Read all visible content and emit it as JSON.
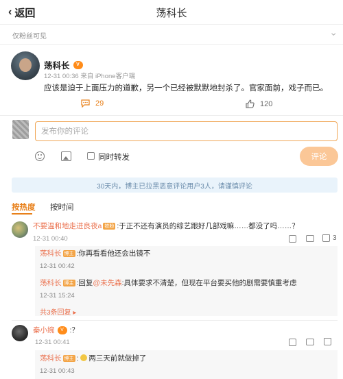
{
  "header": {
    "back_label": "返回",
    "title": "荡科长"
  },
  "visibility": {
    "label": "仅粉丝可见"
  },
  "post": {
    "author": "荡科长",
    "badge": "V",
    "meta": "12-31 00:36 来自 iPhone客户端",
    "content": "应该是迫于上面压力的道歉，另一个已经被默默地封杀了。官家面前，戏子而已。",
    "comment_count": "29",
    "like_count": "120"
  },
  "compose": {
    "placeholder": "发布你的评论",
    "repost_label": "同时转发",
    "submit_label": "评论"
  },
  "notice": "30天内，博主已拉黑恶意评论用户3人，请谨慎评论",
  "tabs": {
    "hot": "按热度",
    "time": "按时间"
  },
  "comments": [
    {
      "nick": "不要温和地走进良夜a",
      "badge": "铁粉",
      "text": ":于正不还有演员的综艺跟好几部戏嘛……都没了吗……？",
      "time": "12-31 00:40",
      "likes": "3",
      "replies": [
        {
          "nick": "荡科长",
          "badge": "博主",
          "text": ":你再看看他还会出镜不",
          "time": "12-31 00:42"
        },
        {
          "nick": "荡科长",
          "badge": "博主",
          "prefix": ":回复",
          "mention": "@未先森",
          "text": ":具体要求不清楚，但现在平台要买他的剧需要慎重考虑",
          "time": "12-31 15:24"
        }
      ],
      "more_replies": "共3条回复 ▸"
    },
    {
      "nick": "秦小婉",
      "badge": "V",
      "text": ":？",
      "time": "12-31 00:41",
      "replies": [
        {
          "nick": "荡科长",
          "badge": "博主",
          "text": "两三天前就做掉了",
          "time": "12-31 00:43"
        }
      ]
    }
  ],
  "colors": {
    "accent": "#e8801a",
    "nick": "#eb7350",
    "notice_bg": "#e9f3fb"
  }
}
